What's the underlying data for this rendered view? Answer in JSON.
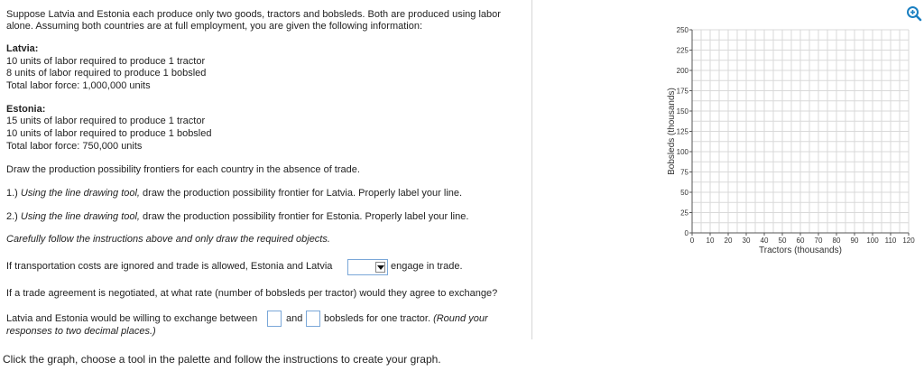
{
  "question": {
    "intro_line1": "Suppose Latvia and Estonia each produce only two goods, tractors and bobsleds. Both are produced using labor",
    "intro_line2": "alone. Assuming both countries are at full employment, you are given the following information:",
    "latvia": {
      "heading": "Latvia:",
      "line1": "10 units of labor required to produce 1 tractor",
      "line2": "8 units of labor required to produce 1 bobsled",
      "line3": "Total labor force: 1,000,000 units"
    },
    "estonia": {
      "heading": "Estonia:",
      "line1": "15 units of labor required to produce 1 tractor",
      "line2": "10 units of labor required to produce 1 bobsled",
      "line3": "Total labor force: 750,000 units"
    },
    "draw_instruction": "Draw the production possibility frontiers for each country in the absence of trade.",
    "step1_prefix": "1.) ",
    "step1_italic": "Using the line drawing tool,",
    "step1_rest": " draw the production possibility frontier for Latvia. Properly label your line.",
    "step2_prefix": "2.) ",
    "step2_italic": "Using the line drawing tool,",
    "step2_rest": " draw the production possibility frontier for Estonia. Properly label your line.",
    "careful_note": "Carefully follow the instructions above and only draw the required objects.",
    "trade_q_before": "If transportation costs are ignored and trade is allowed, Estonia and Latvia",
    "trade_q_after": "engage in trade.",
    "trade_dropdown_value": "",
    "agreement_q": "If a trade agreement is negotiated, at what rate (number of bobsleds per tractor) would they agree to exchange?",
    "exchange_before": "Latvia and Estonia would be willing to exchange between",
    "exchange_and": "and",
    "exchange_after": "bobsleds for one tractor.",
    "round_note_part1": "(Round your",
    "round_note_part2": "responses to two decimal places.)",
    "answer_low": "",
    "answer_high": ""
  },
  "footer": {
    "instruction": "Click the graph, choose a tool in the palette and follow the instructions to create your graph."
  },
  "zoom_icon": "zoom-in-icon",
  "colors": {
    "accent": "#1a7fc1",
    "grid": "#d9d9d9",
    "axis": "#555555"
  },
  "chart_data": {
    "type": "scatter",
    "title": "",
    "xlabel": "Tractors (thousands)",
    "ylabel": "Bobsleds (thousands)",
    "xlim": [
      0,
      120
    ],
    "ylim": [
      0,
      250
    ],
    "x_ticks": [
      0,
      10,
      20,
      30,
      40,
      50,
      60,
      70,
      80,
      90,
      100,
      110,
      120
    ],
    "y_ticks": [
      0,
      25,
      50,
      75,
      100,
      125,
      150,
      175,
      200,
      225,
      250
    ],
    "grid": true,
    "series": []
  }
}
